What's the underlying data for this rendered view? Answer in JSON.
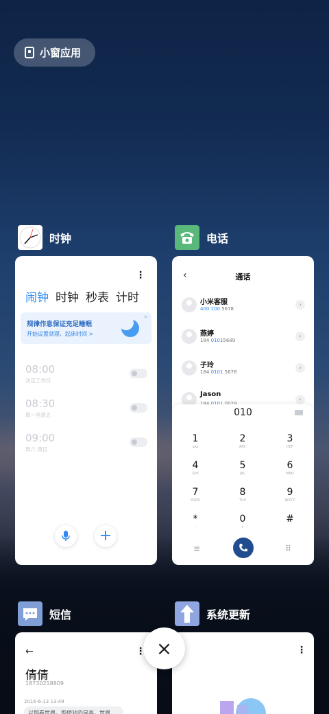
{
  "float_pill": {
    "label": "小窗应用"
  },
  "apps": {
    "clock": {
      "title": "时钟",
      "tabs": [
        "闹钟",
        "时钟",
        "秒表",
        "计时"
      ],
      "banner": {
        "title": "规律作息保证充足睡眠",
        "subtitle": "开始设置就寝、起床时间 >",
        "close": "×"
      },
      "alarms": [
        {
          "time": "08:00",
          "repeat": "法定工作日",
          "enabled": false
        },
        {
          "time": "08:30",
          "repeat": "周一至周五",
          "enabled": false
        },
        {
          "time": "09:00",
          "repeat": "周六 周日",
          "enabled": false
        }
      ],
      "add_label": "+"
    },
    "phone": {
      "title": "电话",
      "screen_title": "通话",
      "back": "‹",
      "contacts": [
        {
          "name": "小米客服",
          "num_pre": "",
          "num_hl": "400 100",
          "num_post": " 5678"
        },
        {
          "name": "燕婷",
          "num_pre": "184 ",
          "num_hl": "010",
          "num_post": "15689"
        },
        {
          "name": "子玲",
          "num_pre": "184 ",
          "num_hl": "0101",
          "num_post": " 5678"
        },
        {
          "name": "Jason",
          "num_pre": "184 ",
          "num_hl": "0101",
          "num_post": " 0029"
        }
      ],
      "dialed": "010",
      "keys": [
        {
          "d": "1",
          "l": "ഥഥ"
        },
        {
          "d": "2",
          "l": "ABC"
        },
        {
          "d": "3",
          "l": "DEF"
        },
        {
          "d": "4",
          "l": "GHI"
        },
        {
          "d": "5",
          "l": "JKL"
        },
        {
          "d": "6",
          "l": "MNO"
        },
        {
          "d": "7",
          "l": "PQRS"
        },
        {
          "d": "8",
          "l": "TUV"
        },
        {
          "d": "9",
          "l": "WXYZ"
        },
        {
          "d": "*",
          "l": ","
        },
        {
          "d": "0",
          "l": "+"
        },
        {
          "d": "#",
          "l": ""
        }
      ],
      "menu_glyph": "≡",
      "grid_glyph": "⠿"
    },
    "sms": {
      "title": "短信",
      "back": "←",
      "contact_name": "倩倩",
      "contact_phone": "18730218809",
      "date": "2016-6-13 13:49",
      "message": "以即看世界，即使站的是高，世界"
    },
    "update": {
      "title": "系统更新"
    }
  },
  "close_label": "×",
  "colors": {
    "accent": "#2f8bf0",
    "call": "#1f4d8f",
    "phone_icon_bg": "#5ab87a",
    "sms_icon_bg": "#7f9fd6",
    "update_icon_bg": "#8fa6e0"
  }
}
